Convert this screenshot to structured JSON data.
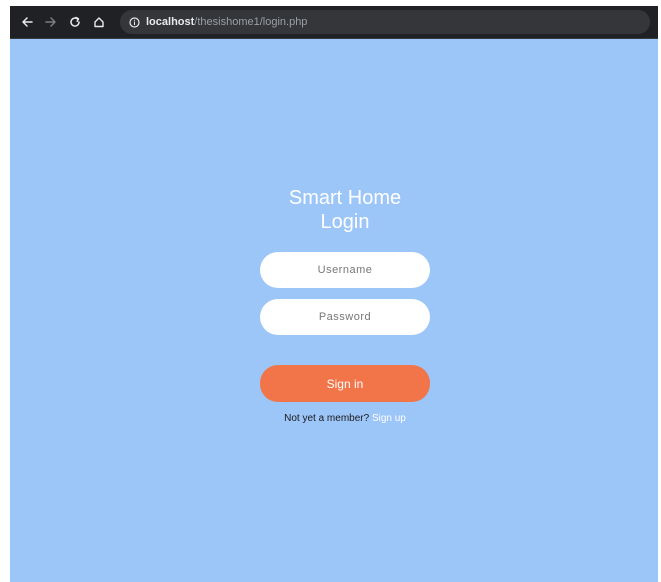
{
  "browser": {
    "url_host": "localhost",
    "url_path": "/thesishome1/login.php",
    "icons": {
      "back": "back-arrow-icon",
      "forward": "forward-arrow-icon",
      "reload": "reload-icon",
      "home": "home-icon",
      "site_info": "info-icon"
    }
  },
  "login": {
    "title_line1": "Smart Home",
    "title_line2": "Login",
    "username_placeholder": "Username",
    "password_placeholder": "Password",
    "signin_label": "Sign in",
    "signup_prompt": "Not yet a member?",
    "signup_link": "Sign up"
  },
  "colors": {
    "page_background": "#9cc5f8",
    "signin_button": "#f2754a",
    "browser_bar": "#202124"
  }
}
